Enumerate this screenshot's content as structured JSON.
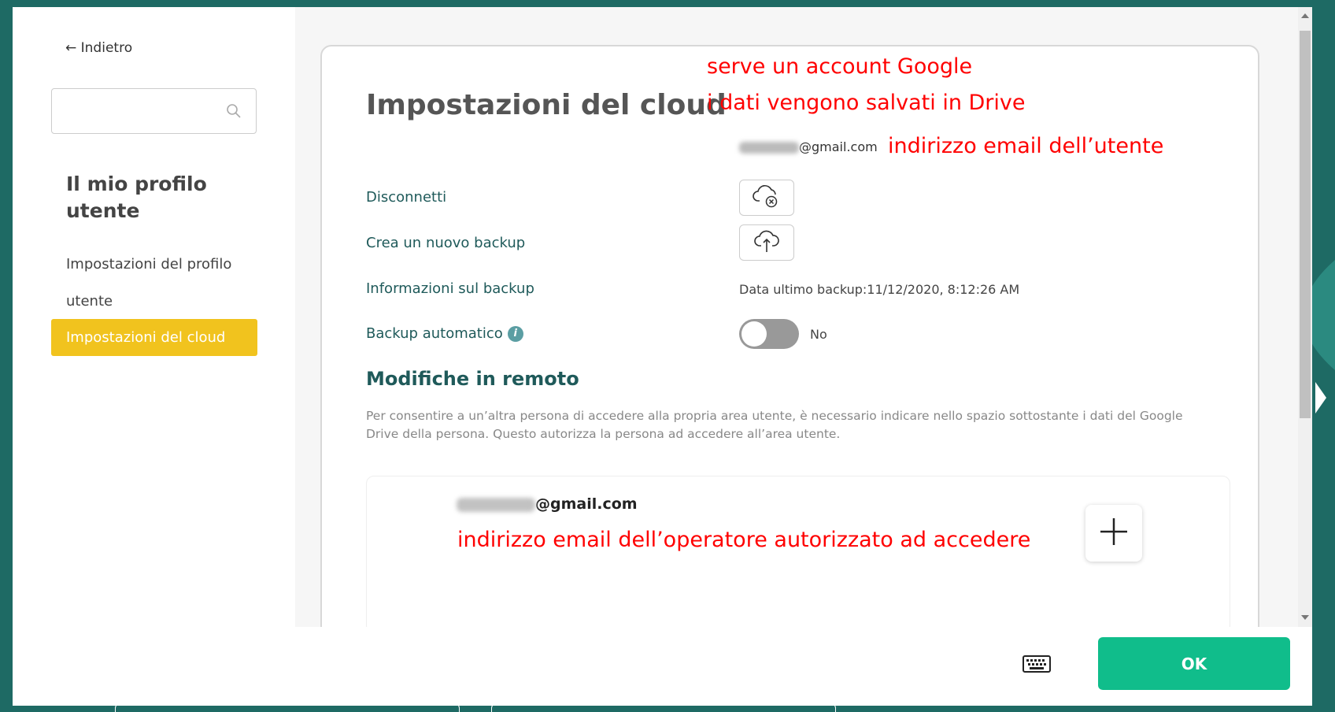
{
  "sidebar": {
    "back_label": "← Indietro",
    "search_placeholder": "",
    "profile_title": "Il mio profilo utente",
    "nav_profile_settings": "Impostazioni del profilo utente",
    "nav_cloud_settings": "Impostazioni del cloud"
  },
  "main": {
    "title": "Impostazioni del cloud",
    "annotations": {
      "google_account": "serve un account Google",
      "saved_in_drive": "i dati vengono salvati in Drive",
      "user_email": "indirizzo email dell’utente",
      "operator_email": "indirizzo email dell’operatore autorizzato ad accedere"
    },
    "account_email_suffix": "@gmail.com",
    "rows": {
      "disconnect": "Disconnetti",
      "new_backup": "Crea un nuovo backup",
      "backup_info": "Informazioni sul backup",
      "auto_backup": "Backup automatico"
    },
    "backup_info_value": "Data ultimo backup:11/12/2020, 8:12:26 AM",
    "auto_backup_state": "No",
    "auto_backup_enabled": false,
    "remote": {
      "title": "Modifiche in remoto",
      "description": "Per consentire a un’altra persona di accedere alla propria area utente, è necessario indicare nello spazio sottostante i dati del Google Drive della persona. Questo autorizza la persona ad accedere all’area utente.",
      "authorized_email_suffix": "@gmail.com"
    }
  },
  "footer": {
    "ok_label": "OK"
  },
  "icons": {
    "cloud_disconnect": "cloud-x-icon",
    "cloud_upload": "cloud-upload-icon",
    "info": "info-icon",
    "plus": "plus-icon",
    "keyboard": "keyboard-icon",
    "search": "search-icon"
  },
  "colors": {
    "accent_yellow": "#f1c31e",
    "ok_green": "#10bd8b",
    "teal_text": "#1f5a5a",
    "annotation_red": "#ff0000",
    "background": "#1e6a64"
  }
}
